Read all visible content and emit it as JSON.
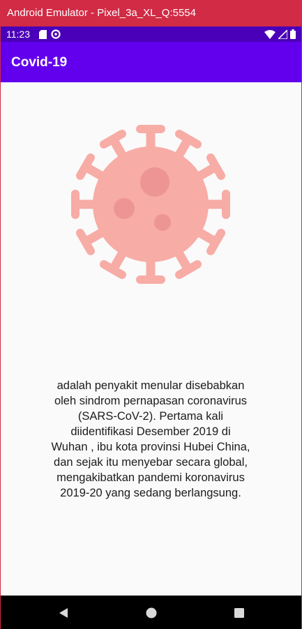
{
  "window": {
    "title": "Android Emulator - Pixel_3a_XL_Q:5554"
  },
  "status_bar": {
    "time": "11:23",
    "icons_left": [
      "sd-card-icon",
      "data-saver-icon"
    ],
    "icons_right": [
      "wifi-icon",
      "signal-icon",
      "battery-icon"
    ]
  },
  "app_bar": {
    "title": "Covid-19",
    "color": "#6200ee"
  },
  "main": {
    "image_icon": "virus-icon",
    "image_color": "#f7aca6",
    "description": "adalah penyakit menular disebabkan\noleh sindrom pernapasan  coronavirus\n(SARS-CoV-2).  Pertama kali\ndiidentifikasi Desember 2019 di\nWuhan , ibu kota provinsi Hubei China,\ndan sejak itu menyebar secara global,\nmengakibatkan pandemi koronavirus\n2019-20 yang sedang berlangsung."
  },
  "nav_bar": {
    "buttons": [
      "back-icon",
      "home-icon",
      "recents-icon"
    ]
  }
}
